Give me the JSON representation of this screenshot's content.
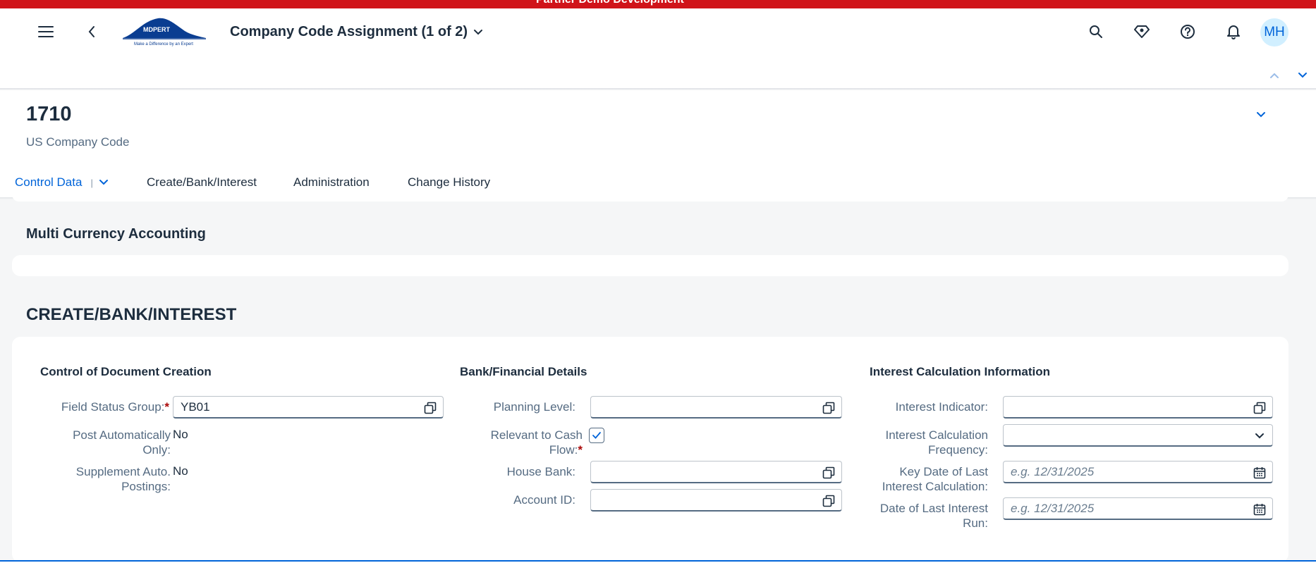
{
  "system_banner": "Partner Demo Development",
  "shell": {
    "app_title": "Company Code Assignment (1 of 2)",
    "logo_text": "MDPERT",
    "logo_tagline": "Make a Difference by an Expert",
    "avatar_initials": "MH"
  },
  "header": {
    "title": "1710",
    "subtitle": "US Company Code"
  },
  "tabs": [
    {
      "label": "Control Data"
    },
    {
      "label": "Create/Bank/Interest"
    },
    {
      "label": "Administration"
    },
    {
      "label": "Change History"
    }
  ],
  "sections": {
    "multi_currency": "Multi Currency Accounting",
    "create_bank_interest": "CREATE/BANK/INTEREST"
  },
  "groups": {
    "control": {
      "title": "Control of Document Creation",
      "field_status_group_label": "Field Status Group:",
      "field_status_group_value": "YB01",
      "post_auto_label_1": "Post Automatically",
      "post_auto_label_2": "Only:",
      "post_auto_value": "No",
      "supplement_label_1": "Supplement Auto.",
      "supplement_label_2": "Postings:",
      "supplement_value": "No"
    },
    "bank": {
      "title": "Bank/Financial Details",
      "planning_level_label": "Planning Level:",
      "planning_level_value": "",
      "cash_flow_label_1": "Relevant to Cash",
      "cash_flow_label_2": "Flow:",
      "cash_flow_checked": true,
      "house_bank_label": "House Bank:",
      "house_bank_value": "",
      "account_id_label": "Account ID:",
      "account_id_value": ""
    },
    "interest": {
      "title": "Interest Calculation Information",
      "indicator_label": "Interest Indicator:",
      "indicator_value": "",
      "frequency_label_1": "Interest Calculation",
      "frequency_label_2": "Frequency:",
      "frequency_value": "",
      "key_date_label_1": "Key Date of Last",
      "key_date_label_2": "Interest Calculation:",
      "key_date_placeholder": "e.g. 12/31/2025",
      "last_run_label_1": "Date of Last Interest",
      "last_run_label_2": "Run:",
      "last_run_placeholder": "e.g. 12/31/2025"
    }
  },
  "colors": {
    "accent": "#0064d9",
    "banner": "#d0141a",
    "required": "#aa0808"
  }
}
